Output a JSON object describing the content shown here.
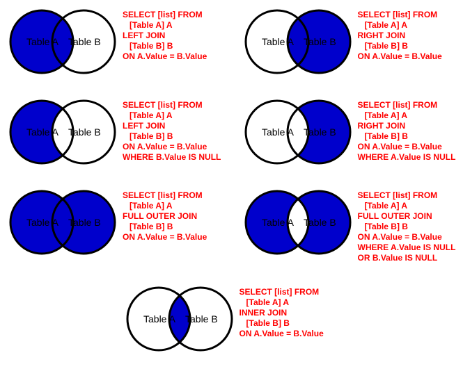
{
  "colors": {
    "fill": "#0000cc",
    "empty": "#ffffff",
    "text": "#ff0000",
    "stroke": "#000000"
  },
  "labels": {
    "tableA": "Table A",
    "tableB": "Table B"
  },
  "joins": [
    {
      "id": "left-join",
      "venn": {
        "left": true,
        "right": false,
        "intersection": true
      },
      "sql": "SELECT [list] FROM\n   [Table A] A\nLEFT JOIN\n   [Table B] B\nON A.Value = B.Value"
    },
    {
      "id": "right-join",
      "venn": {
        "left": false,
        "right": true,
        "intersection": true
      },
      "sql": "SELECT [list] FROM\n   [Table A] A\nRIGHT JOIN\n   [Table B] B\nON A.Value = B.Value"
    },
    {
      "id": "left-excl-join",
      "venn": {
        "left": true,
        "right": false,
        "intersection": false
      },
      "sql": "SELECT [list] FROM\n   [Table A] A\nLEFT JOIN\n   [Table B] B\nON A.Value = B.Value\nWHERE B.Value IS NULL"
    },
    {
      "id": "right-excl-join",
      "venn": {
        "left": false,
        "right": true,
        "intersection": false
      },
      "sql": "SELECT [list] FROM\n   [Table A] A\nRIGHT JOIN\n   [Table B] B\nON A.Value = B.Value\nWHERE A.Value IS NULL"
    },
    {
      "id": "full-outer-join",
      "venn": {
        "left": true,
        "right": true,
        "intersection": true
      },
      "sql": "SELECT [list] FROM\n   [Table A] A\nFULL OUTER JOIN\n   [Table B] B\nON A.Value = B.Value"
    },
    {
      "id": "full-outer-excl-join",
      "venn": {
        "left": true,
        "right": true,
        "intersection": false
      },
      "sql": "SELECT [list] FROM\n   [Table A] A\nFULL OUTER JOIN\n   [Table B] B\nON A.Value = B.Value\nWHERE A.Value IS NULL\nOR B.Value IS NULL"
    },
    {
      "id": "inner-join",
      "venn": {
        "left": false,
        "right": false,
        "intersection": true
      },
      "sql": "SELECT [list] FROM\n   [Table A] A\nINNER JOIN\n   [Table B] B\nON A.Value = B.Value"
    }
  ],
  "layout": {
    "rows": [
      [
        "left-join",
        "right-join"
      ],
      [
        "left-excl-join",
        "right-excl-join"
      ],
      [
        "full-outer-join",
        "full-outer-excl-join"
      ],
      [
        "inner-join"
      ]
    ]
  }
}
